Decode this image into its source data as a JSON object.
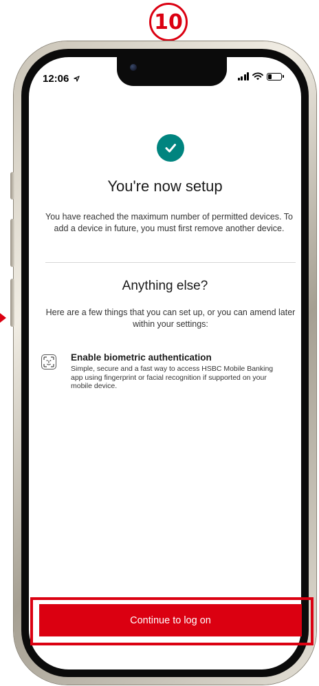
{
  "step": {
    "number": "10"
  },
  "status_bar": {
    "time": "12:06"
  },
  "content": {
    "title": "You're now setup",
    "message": "You have reached the maximum number of permitted devices. To add a device in future, you must first remove another device.",
    "subtitle": "Anything else?",
    "intro": "Here are a few things that you can set up, or you can amend later within your settings:",
    "features": [
      {
        "icon": "face-id-icon",
        "title": "Enable biometric authentication",
        "description": "Simple, secure and a fast way to access HSBC Mobile Banking app using fingerprint or facial recognition if supported on your mobile device."
      }
    ]
  },
  "actions": {
    "continue_label": "Continue to log on"
  },
  "colors": {
    "brand_red": "#db0011",
    "success_teal": "#00847f",
    "text_dark": "#1a1a1a"
  }
}
